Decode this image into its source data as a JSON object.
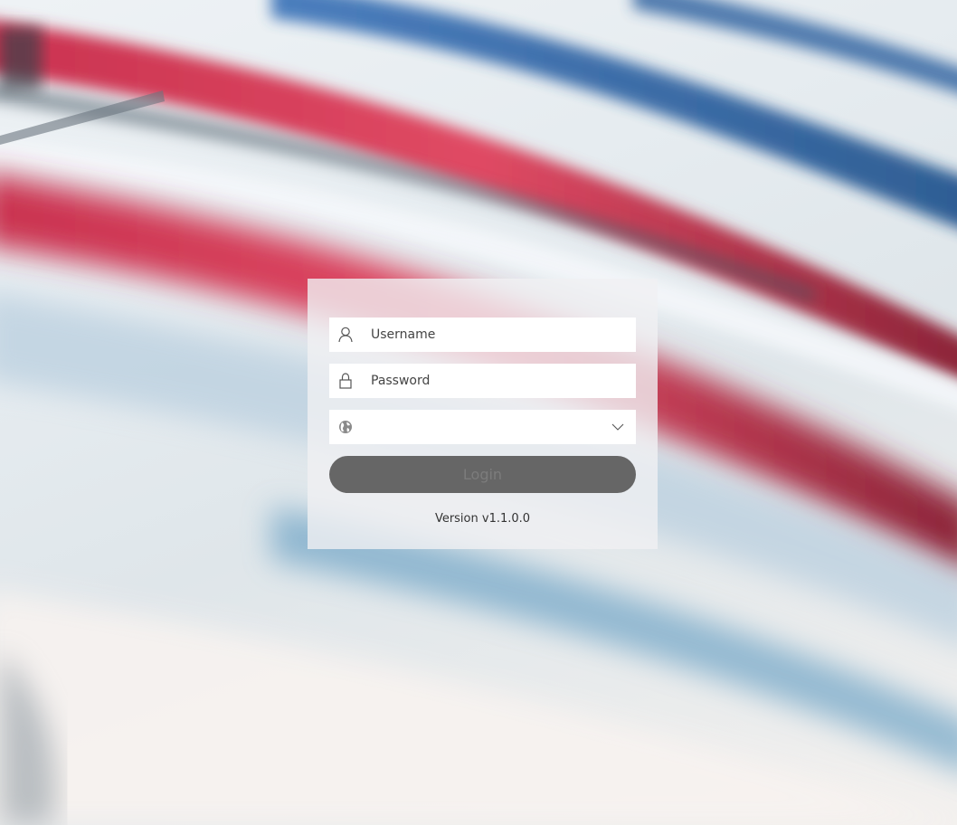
{
  "login": {
    "username_placeholder": "Username",
    "password_placeholder": "Password",
    "region_value": "",
    "login_label": "Login",
    "version_text": "Version v1.1.0.0"
  },
  "icons": {
    "username": "user-icon",
    "password": "lock-icon",
    "region": "globe-icon",
    "dropdown": "chevron-down-icon"
  },
  "colors": {
    "login_button": "#666666",
    "login_text": "#7c7c7c",
    "card": "#f0f0f2"
  }
}
